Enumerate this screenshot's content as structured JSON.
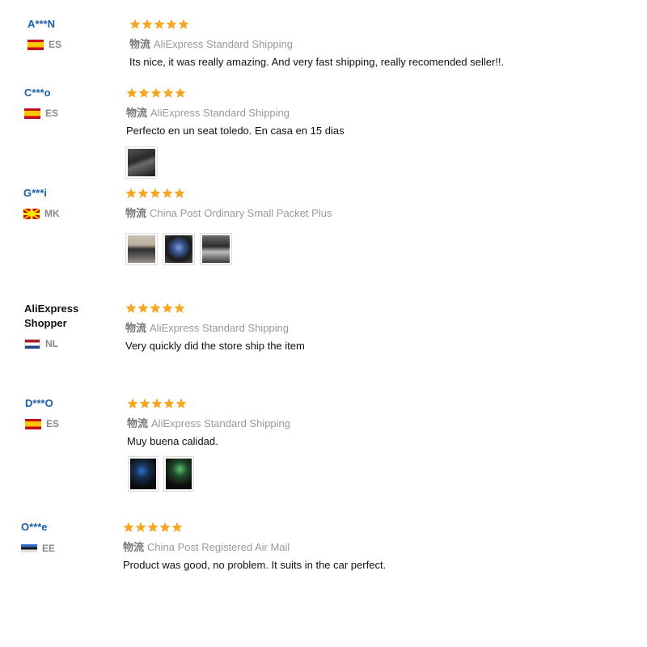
{
  "reviews": [
    {
      "user": "A***N",
      "country": "ES",
      "stars": 5,
      "shipping_cn": "物流",
      "shipping": "AliExpress Standard Shipping",
      "text": "Its nice, it was really amazing. And very fast shipping, really recomended seller!!.",
      "photos": []
    },
    {
      "user": "C***o",
      "country": "ES",
      "stars": 5,
      "shipping_cn": "物流",
      "shipping": "AliExpress Standard Shipping",
      "text": "Perfecto en un seat toledo. En casa en 15 dias",
      "photos": [
        "dashboard-photo"
      ]
    },
    {
      "user": "G***i",
      "country": "MK",
      "stars": 5,
      "shipping_cn": "物流",
      "shipping": "China Post Ordinary Small Packet Plus",
      "text": "",
      "photos": [
        "frame-photo",
        "screen-photo",
        "panel-photo"
      ]
    },
    {
      "user": "AliExpress Shopper",
      "country": "NL",
      "stars": 5,
      "shipping_cn": "物流",
      "shipping": "AliExpress Standard Shipping",
      "text": "Very quickly did the store ship the item",
      "photos": []
    },
    {
      "user": "D***O",
      "country": "ES",
      "stars": 5,
      "shipping_cn": "物流",
      "shipping": "AliExpress Standard Shipping",
      "text": "Muy buena calidad.",
      "photos": [
        "screen-blue-photo",
        "screen-green-photo"
      ]
    },
    {
      "user": "O***e",
      "country": "EE",
      "stars": 5,
      "shipping_cn": "物流",
      "shipping": "China Post Registered Air Mail",
      "text": "Product was good, no problem. It suits in the car perfect.",
      "photos": []
    }
  ],
  "colors": {
    "username": "#1a5fa8",
    "star": "#f5a623",
    "muted": "#999999"
  }
}
